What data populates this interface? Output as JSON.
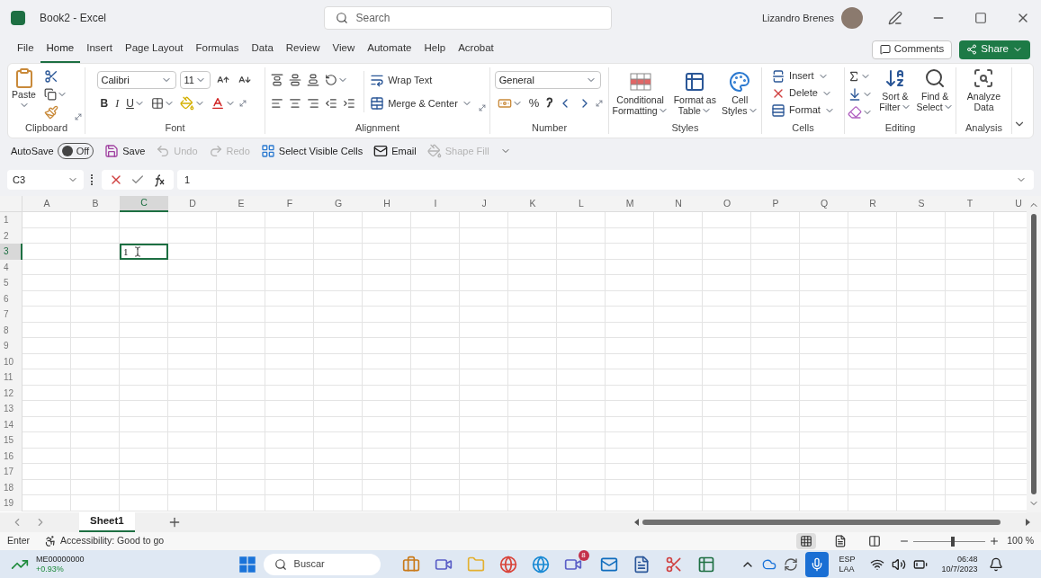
{
  "window": {
    "title": "Book2 - Excel",
    "search_placeholder": "Search",
    "user": "Lizandro Brenes"
  },
  "menu_tabs": [
    {
      "label": "File",
      "selected": false
    },
    {
      "label": "Home",
      "selected": true
    },
    {
      "label": "Insert",
      "selected": false
    },
    {
      "label": "Page Layout",
      "selected": false
    },
    {
      "label": "Formulas",
      "selected": false
    },
    {
      "label": "Data",
      "selected": false
    },
    {
      "label": "Review",
      "selected": false
    },
    {
      "label": "View",
      "selected": false
    },
    {
      "label": "Automate",
      "selected": false
    },
    {
      "label": "Help",
      "selected": false
    },
    {
      "label": "Acrobat",
      "selected": false
    }
  ],
  "comments": "Comments",
  "share": "Share",
  "ribbon": [
    {
      "kind": "clipboard",
      "label": "Clipboard",
      "paste": "Paste"
    },
    {
      "kind": "font",
      "label": "Font",
      "font": "Calibri",
      "size": "11",
      "bold": "B",
      "italic": "I",
      "underline": "U"
    },
    {
      "kind": "alignment",
      "label": "Alignment",
      "wrap": "Wrap Text",
      "merge": "Merge & Center"
    },
    {
      "kind": "number",
      "label": "Number",
      "format": "General",
      "percent": "%"
    },
    {
      "kind": "styles",
      "label": "Styles",
      "buttons": [
        {
          "lines": [
            "Conditional",
            "Formatting"
          ]
        },
        {
          "lines": [
            "Format as",
            "Table"
          ]
        },
        {
          "lines": [
            "Cell",
            "Styles"
          ]
        }
      ]
    },
    {
      "kind": "cells",
      "label": "Cells",
      "buttons": [
        "Insert",
        "Delete",
        "Format"
      ]
    },
    {
      "kind": "editing",
      "label": "Editing",
      "buttons": [
        {
          "lines": [
            "Sort &",
            "Filter"
          ]
        },
        {
          "lines": [
            "Find &",
            "Select"
          ]
        }
      ]
    },
    {
      "kind": "analysis",
      "label": "Analysis",
      "buttons": [
        {
          "lines": [
            "Analyze",
            "Data"
          ]
        }
      ]
    }
  ],
  "quick_access": {
    "autosave_label": "AutoSave",
    "autosave_on": false,
    "autosave_state": "Off",
    "items": [
      {
        "label": "Save",
        "disabled": false
      },
      {
        "label": "Undo",
        "disabled": true
      },
      {
        "label": "Redo",
        "disabled": true
      },
      {
        "label": "Select Visible Cells",
        "disabled": false
      },
      {
        "label": "Email",
        "disabled": false
      },
      {
        "label": "Shape Fill",
        "disabled": true
      }
    ]
  },
  "formula_bar": {
    "name_box": "C3",
    "formula": "1"
  },
  "sheet": {
    "columns": [
      {
        "label": "A",
        "selected": false
      },
      {
        "label": "B",
        "selected": false
      },
      {
        "label": "C",
        "selected": true
      },
      {
        "label": "D",
        "selected": false
      },
      {
        "label": "E",
        "selected": false
      },
      {
        "label": "F",
        "selected": false
      },
      {
        "label": "G",
        "selected": false
      },
      {
        "label": "H",
        "selected": false
      },
      {
        "label": "I",
        "selected": false
      },
      {
        "label": "J",
        "selected": false
      },
      {
        "label": "K",
        "selected": false
      },
      {
        "label": "L",
        "selected": false
      },
      {
        "label": "M",
        "selected": false
      },
      {
        "label": "N",
        "selected": false
      },
      {
        "label": "O",
        "selected": false
      },
      {
        "label": "P",
        "selected": false
      },
      {
        "label": "Q",
        "selected": false
      },
      {
        "label": "R",
        "selected": false
      },
      {
        "label": "S",
        "selected": false
      },
      {
        "label": "T",
        "selected": false
      },
      {
        "label": "U",
        "selected": false
      }
    ],
    "rows": [
      {
        "label": "1",
        "selected": false
      },
      {
        "label": "2",
        "selected": false
      },
      {
        "label": "3",
        "selected": true,
        "cells": [
          null,
          null,
          {
            "value": "1",
            "selected": true
          }
        ]
      },
      {
        "label": "4",
        "selected": false
      },
      {
        "label": "5",
        "selected": false
      },
      {
        "label": "6",
        "selected": false
      },
      {
        "label": "7",
        "selected": false
      },
      {
        "label": "8",
        "selected": false
      },
      {
        "label": "9",
        "selected": false
      },
      {
        "label": "10",
        "selected": false
      },
      {
        "label": "11",
        "selected": false
      },
      {
        "label": "12",
        "selected": false
      },
      {
        "label": "13",
        "selected": false
      },
      {
        "label": "14",
        "selected": false
      },
      {
        "label": "15",
        "selected": false
      },
      {
        "label": "16",
        "selected": false
      },
      {
        "label": "17",
        "selected": false
      },
      {
        "label": "18",
        "selected": false
      },
      {
        "label": "19",
        "selected": false
      }
    ]
  },
  "sheet_tabs": [
    {
      "label": "Sheet1",
      "selected": true
    }
  ],
  "status_bar": {
    "mode": "Enter",
    "accessibility": "Accessibility: Good to go",
    "views": [
      {
        "kind": "normal",
        "selected": true
      },
      {
        "kind": "page-layout",
        "selected": false
      },
      {
        "kind": "page-break",
        "selected": false
      }
    ],
    "zoom": {
      "level": 0.55,
      "reading": "100 %"
    }
  },
  "taskbar": {
    "stock_symbol": "ME00000000",
    "stock_change": "+0.93%",
    "search_placeholder": "Buscar",
    "badge": "8",
    "language": "ESP",
    "region": "LAA",
    "time": "06:48",
    "date": "10/7/2023"
  }
}
